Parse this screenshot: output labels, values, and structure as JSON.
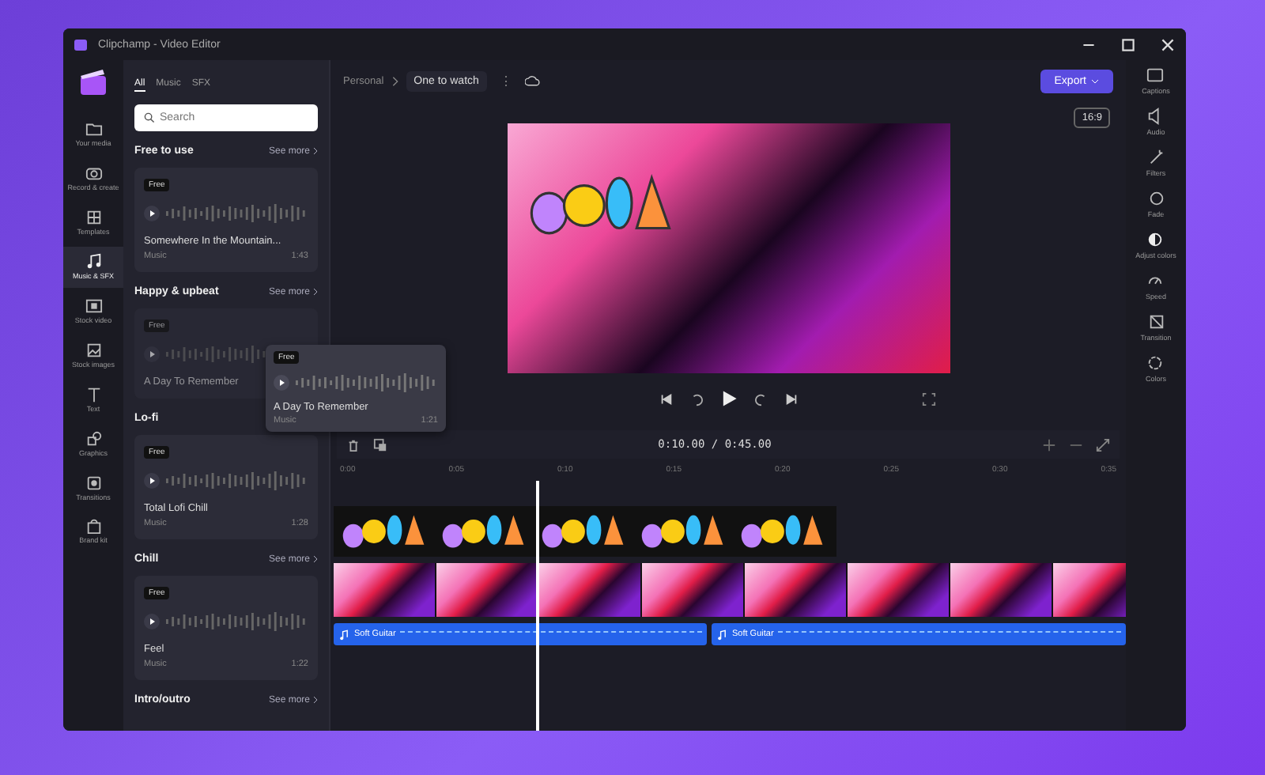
{
  "window": {
    "title": "Clipchamp - Video Editor"
  },
  "nav": [
    {
      "label": "Your media",
      "selected": false
    },
    {
      "label": "Record & create",
      "selected": false
    },
    {
      "label": "Templates",
      "selected": false
    },
    {
      "label": "Music & SFX",
      "selected": true
    },
    {
      "label": "Stock video",
      "selected": false
    },
    {
      "label": "Stock images",
      "selected": false
    },
    {
      "label": "Text",
      "selected": false
    },
    {
      "label": "Graphics",
      "selected": false
    },
    {
      "label": "Transitions",
      "selected": false
    },
    {
      "label": "Brand kit",
      "selected": false
    }
  ],
  "assets": {
    "tabs": [
      {
        "label": "All",
        "selected": true
      },
      {
        "label": "Music",
        "selected": false
      },
      {
        "label": "SFX",
        "selected": false
      }
    ],
    "search": {
      "placeholder": "Search"
    },
    "sections": [
      {
        "title": "Free to use",
        "see_more": "See more",
        "cards": [
          {
            "badge": "Free",
            "title": "Somewhere In the Mountain...",
            "type": "Music",
            "duration": "1:43",
            "dragging": false
          }
        ]
      },
      {
        "title": "Happy & upbeat",
        "see_more": "See more",
        "cards": [
          {
            "badge": "Free",
            "title": "A Day To Remember",
            "dragging": true
          }
        ]
      },
      {
        "title": "Lo-fi",
        "cards": [
          {
            "badge": "Free",
            "title": "Total Lofi Chill",
            "type": "Music",
            "duration": "1:28",
            "dragging": false
          }
        ]
      },
      {
        "title": "Chill",
        "see_more": "See more",
        "cards": [
          {
            "badge": "Free",
            "title": "Feel",
            "type": "Music",
            "duration": "1:22",
            "dragging": false
          }
        ]
      },
      {
        "title": "Intro/outro",
        "see_more": "See more"
      }
    ]
  },
  "drag_preview": {
    "badge": "Free",
    "title": "A Day To Remember",
    "type": "Music",
    "duration": "1:21"
  },
  "project": {
    "breadcrumb": "Personal",
    "name": "One to watch",
    "more": "⋮"
  },
  "export": {
    "label": "Export"
  },
  "aspect_ratio": "16:9",
  "timeline": {
    "timecode": "0:10.00 / 0:45.00",
    "ticks": [
      "0:00",
      "0:05",
      "0:10",
      "0:15",
      "0:20",
      "0:25",
      "0:30",
      "0:35"
    ],
    "audio_clips": [
      {
        "label": "Soft Guitar"
      },
      {
        "label": "Soft Guitar"
      }
    ]
  },
  "right_rail": [
    {
      "label": "Captions"
    },
    {
      "label": "Audio"
    },
    {
      "label": "Filters"
    },
    {
      "label": "Fade"
    },
    {
      "label": "Adjust colors"
    },
    {
      "label": "Speed"
    },
    {
      "label": "Transition"
    },
    {
      "label": "Colors"
    }
  ]
}
